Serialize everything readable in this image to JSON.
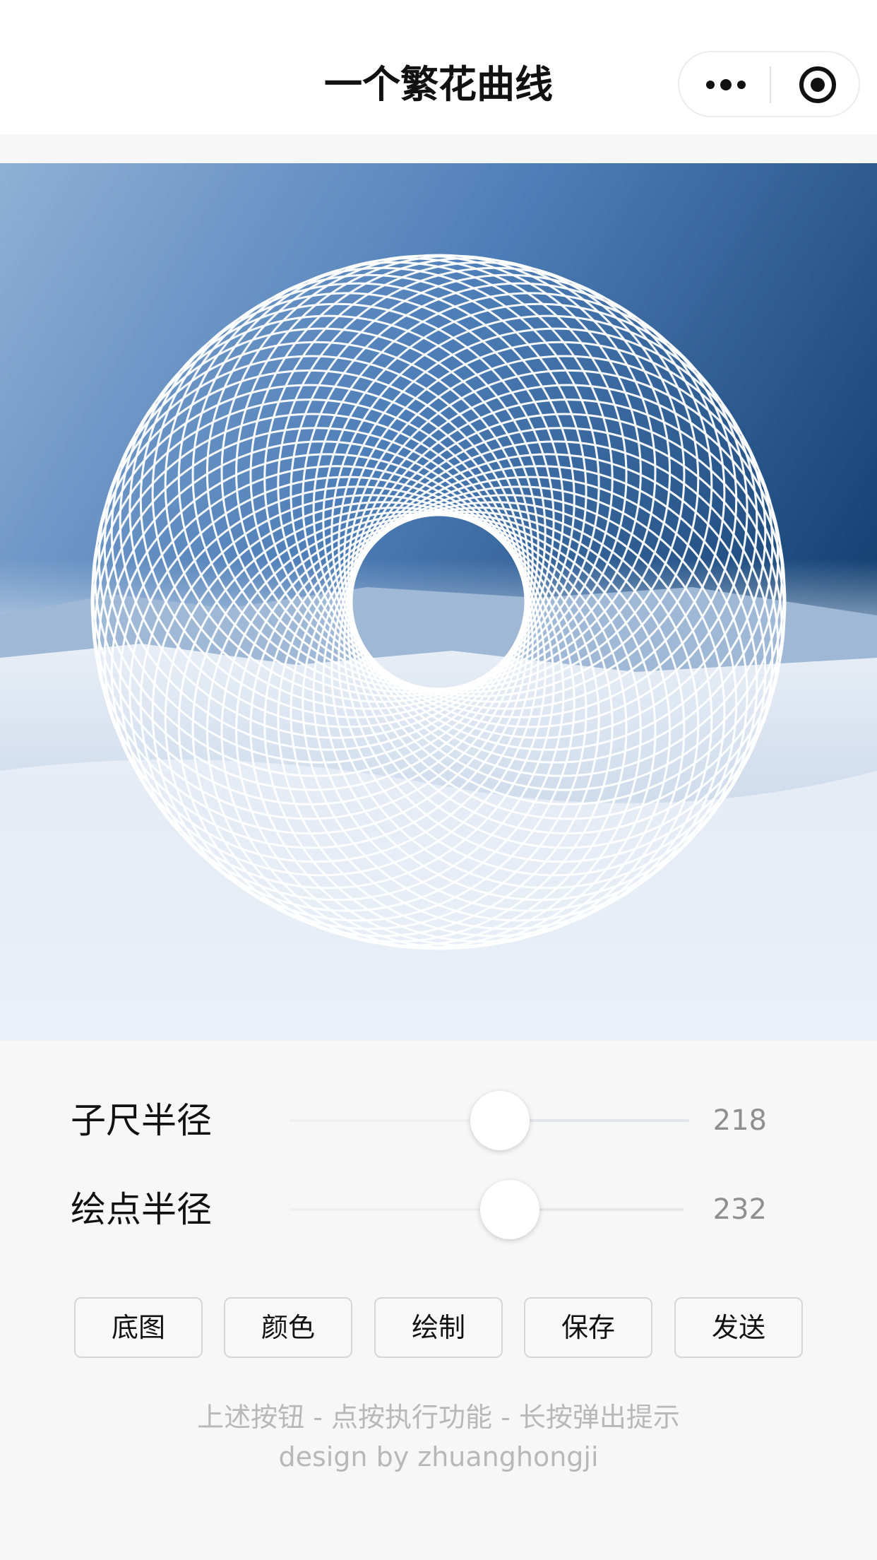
{
  "navbar": {
    "title": "一个繁花曲线",
    "more_icon": "more-dots-icon",
    "close_icon": "target-record-icon"
  },
  "canvas": {
    "background": "snow-mountain-landscape",
    "curve_color": "#ffffff"
  },
  "sliders": [
    {
      "label": "子尺半径",
      "value": "218",
      "fill": 0.45
    },
    {
      "label": "绘点半径",
      "value": "232",
      "fill": 0.49
    }
  ],
  "buttons": [
    {
      "label": "底图"
    },
    {
      "label": "颜色"
    },
    {
      "label": "绘制"
    },
    {
      "label": "保存"
    },
    {
      "label": "发送"
    }
  ],
  "footer": {
    "hint": "上述按钮 - 点按执行功能 - 长按弹出提示",
    "credit": "design by zhuanghongji"
  }
}
